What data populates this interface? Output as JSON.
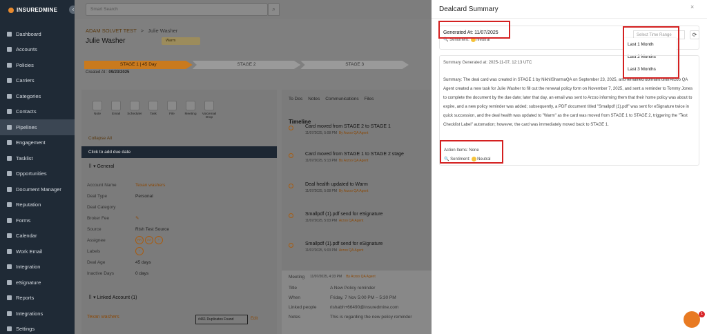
{
  "app": {
    "logo": "INSUREDMINE"
  },
  "sidebar": {
    "items": [
      {
        "label": "Dashboard"
      },
      {
        "label": "Accounts"
      },
      {
        "label": "Policies"
      },
      {
        "label": "Carriers"
      },
      {
        "label": "Categories"
      },
      {
        "label": "Contacts"
      },
      {
        "label": "Pipelines"
      },
      {
        "label": "Engagement"
      },
      {
        "label": "Tasklist"
      },
      {
        "label": "Opportunities"
      },
      {
        "label": "Document Manager"
      },
      {
        "label": "Reputation"
      },
      {
        "label": "Forms"
      },
      {
        "label": "Calendar"
      },
      {
        "label": "Work Email"
      },
      {
        "label": "Integration"
      },
      {
        "label": "eSignature"
      },
      {
        "label": "Reports"
      },
      {
        "label": "Integrations"
      },
      {
        "label": "Settings"
      }
    ],
    "active_index": 6
  },
  "topbar": {
    "search_placeholder": "Smart Search"
  },
  "deal": {
    "breadcrumb_account": "ADAM SOLVET TEST",
    "breadcrumb_sep": ">",
    "breadcrumb_current": "Julie Washer",
    "title": "Julie Washer",
    "tag": "Warm",
    "stages": [
      "STAGE 1 | 45 Day",
      "STAGE 2",
      "STAGE 3"
    ],
    "created_label": "Created At :",
    "created_value": "09/23/2025"
  },
  "actions": [
    "Note",
    "Email",
    "Scheduler",
    "Task",
    "File",
    "Meeting",
    "Voicemail Drop"
  ],
  "left": {
    "collapse_all": "Collapse All",
    "due_date": "Click to add due date",
    "general_header": "General",
    "fields": [
      {
        "label": "Account Name",
        "value": "Texan washers"
      },
      {
        "label": "Deal Type",
        "value": "Personal"
      },
      {
        "label": "Deal Category",
        "value": ""
      },
      {
        "label": "Broker Fee",
        "value": ""
      },
      {
        "label": "Source",
        "value": "Rish Test Source"
      },
      {
        "label": "Assignee",
        "value": ""
      },
      {
        "label": "Labels",
        "value": ""
      },
      {
        "label": "Deal Age",
        "value": "45 days"
      },
      {
        "label": "Inactive Days",
        "value": "0 days"
      }
    ],
    "assignee_initials": [
      "RK",
      "AA"
    ],
    "linked_header": "Linked Account (1)",
    "linked_name": "Texan washers",
    "duplicates": "#461 Duplicates Found",
    "edit": "Edit"
  },
  "middle": {
    "tabs": [
      "To Dos",
      "Notes",
      "Communications",
      "Files"
    ],
    "timeline_heading": "Timeline",
    "items": [
      {
        "title": "Card moved from STAGE 2 to STAGE 1",
        "date": "11/07/2025, 5:08 PM",
        "by": "By Arzoo QA Agent"
      },
      {
        "title": "Card moved from STAGE 1 to STAGE 2 stage",
        "date": "11/07/2025, 5:13 PM",
        "by": "By Arzoo QA Agent"
      },
      {
        "title": "Deal health updated to Warm",
        "date": "11/07/2025, 5:08 PM",
        "by": "By Arzoo QA Agent"
      },
      {
        "title": "Smallpdf (1).pdf send for eSignature",
        "date": "11/07/2025, 5:03 PM",
        "by": "Arzoo QA Agent"
      },
      {
        "title": "Smallpdf (1).pdf send for eSignature",
        "date": "11/07/2025, 5:03 PM",
        "by": "Arzoo QA Agent"
      }
    ],
    "meeting": {
      "header": "Meeting",
      "header_meta": "11/07/2025, 4:33 PM",
      "header_by": "By Arzoo QA Agent",
      "rows": [
        {
          "k": "Title",
          "v": "A New Policy reminder"
        },
        {
          "k": "When",
          "v": "Friday, 7 Nov    5:00 PM – 5:30 PM"
        },
        {
          "k": "Linked people",
          "v": "rishabh+66490@insuredmine.com"
        },
        {
          "k": "Notes",
          "v": "This is regarding  the new policy reminder"
        }
      ]
    }
  },
  "dealcard": {
    "title": "Dealcard Summary",
    "close": "×",
    "generated_at": "Generated At: 11/07/2025",
    "sentiment_top": "Sentiment:",
    "sentiment_top_value": "Neutral",
    "select_placeholder": "Select Time Range",
    "refresh_icon": "⟳",
    "time_ranges": [
      "Last 1 Month",
      "Last 2 Months",
      "Last 3 Months"
    ],
    "summary_generated": "Summary Generated at: 2025-11-07, 12:13 UTC",
    "summary": "Summary: The deal card was created in STAGE 1 by NikhilSharmaQA on September 23, 2025, and remained dormant until Arzoo QA Agent created a new task for Julie Washer to fill out the renewal policy form on November 7, 2025, and sent a reminder to Tommy Jones to complete the document by the due date; later that day, an email was sent to Arzoo informing them that their home policy was about to expire, and a new policy reminder was added; subsequently, a PDF document titled \"Smallpdf (1).pdf\" was sent for eSignature twice in quick succession, and the deal health was updated to \"Warm\" as the card was moved from STAGE 1 to STAGE 2, triggering the \"Test Checklist Label\" automation; however, the card was immediately moved back to STAGE 1.",
    "action_items": "Action Items: None",
    "sentiment_bottom": "Sentiment:",
    "sentiment_bottom_value": "Neutral"
  },
  "help": {
    "badge": "1"
  },
  "colors": {
    "accent": "#e87a22",
    "highlight": "#d42020",
    "sidebar": "#1f2a36"
  }
}
